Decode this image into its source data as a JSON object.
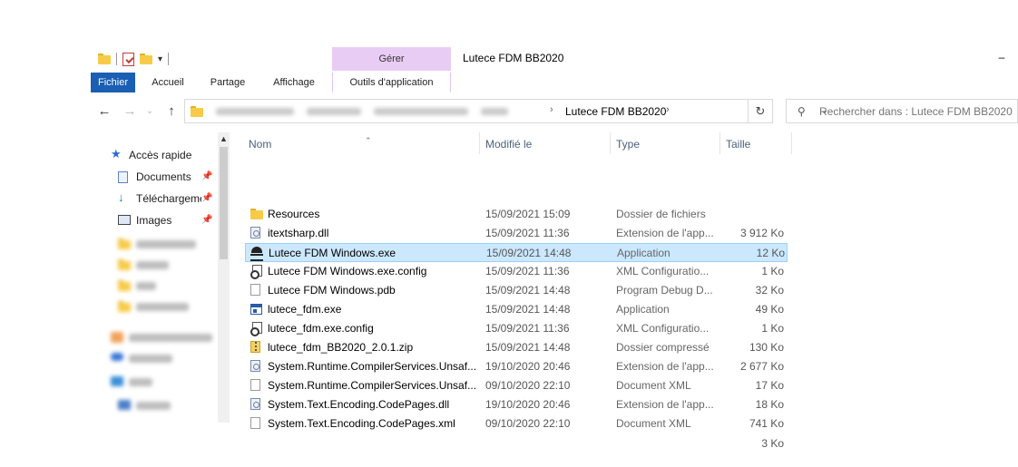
{
  "titlebar": {
    "title": "Lutece FDM BB2020",
    "context_group": "Gérer",
    "minimize_glyph": "–"
  },
  "ribbon": {
    "tabs": [
      "Fichier",
      "Accueil",
      "Partage",
      "Affichage",
      "Outils d'application"
    ]
  },
  "address": {
    "current": "Lutece FDM BB2020",
    "search_placeholder": "Rechercher dans : Lutece FDM BB2020"
  },
  "navpane": {
    "quick_access": "Accès rapide",
    "pinned": [
      {
        "label": "Documents",
        "icon": "document-icon"
      },
      {
        "label": "Téléchargements",
        "icon": "download-icon"
      },
      {
        "label": "Images",
        "icon": "images-icon"
      }
    ]
  },
  "list": {
    "columns": {
      "name": "Nom",
      "modified": "Modifié le",
      "type": "Type",
      "size": "Taille"
    },
    "rows": [
      {
        "name": "Resources",
        "date": "15/09/2021 15:09",
        "type": "Dossier de fichiers",
        "size": "",
        "icon": "folder-icon"
      },
      {
        "name": "itextsharp.dll",
        "date": "15/09/2021 11:36",
        "type": "Extension de l'app...",
        "size": "3 912 Ko",
        "icon": "dll-icon"
      },
      {
        "name": "Lutece FDM Windows.exe",
        "date": "15/09/2021 14:48",
        "type": "Application",
        "size": "12 Ko",
        "icon": "lutece-app-icon",
        "selected": true
      },
      {
        "name": "Lutece FDM Windows.exe.config",
        "date": "15/09/2021 11:36",
        "type": "XML Configuratio...",
        "size": "1 Ko",
        "icon": "config-icon"
      },
      {
        "name": "Lutece FDM Windows.pdb",
        "date": "15/09/2021 14:48",
        "type": "Program Debug D...",
        "size": "32 Ko",
        "icon": "file-icon"
      },
      {
        "name": "lutece_fdm.exe",
        "date": "15/09/2021 14:48",
        "type": "Application",
        "size": "49 Ko",
        "icon": "app-icon"
      },
      {
        "name": "lutece_fdm.exe.config",
        "date": "15/09/2021 11:36",
        "type": "XML Configuratio...",
        "size": "1 Ko",
        "icon": "config-icon"
      },
      {
        "name": "lutece_fdm_BB2020_2.0.1.zip",
        "date": "15/09/2021 14:48",
        "type": "Dossier compressé",
        "size": "130 Ko",
        "icon": "zip-icon"
      },
      {
        "name": "System.Runtime.CompilerServices.Unsaf...",
        "date": "19/10/2020 20:46",
        "type": "Extension de l'app...",
        "size": "2 677 Ko",
        "icon": "dll-icon"
      },
      {
        "name": "System.Runtime.CompilerServices.Unsaf...",
        "date": "09/10/2020 22:10",
        "type": "Document XML",
        "size": "17 Ko",
        "icon": "file-icon"
      },
      {
        "name": "System.Text.Encoding.CodePages.dll",
        "date": "19/10/2020 20:46",
        "type": "Extension de l'app...",
        "size": "18 Ko",
        "icon": "dll-icon"
      },
      {
        "name": "System.Text.Encoding.CodePages.xml",
        "date": "09/10/2020 22:10",
        "type": "Document XML",
        "size": "741 Ko",
        "icon": "file-icon"
      },
      {
        "name": "",
        "date": "",
        "type": "",
        "size": "3 Ko",
        "icon": ""
      }
    ]
  }
}
